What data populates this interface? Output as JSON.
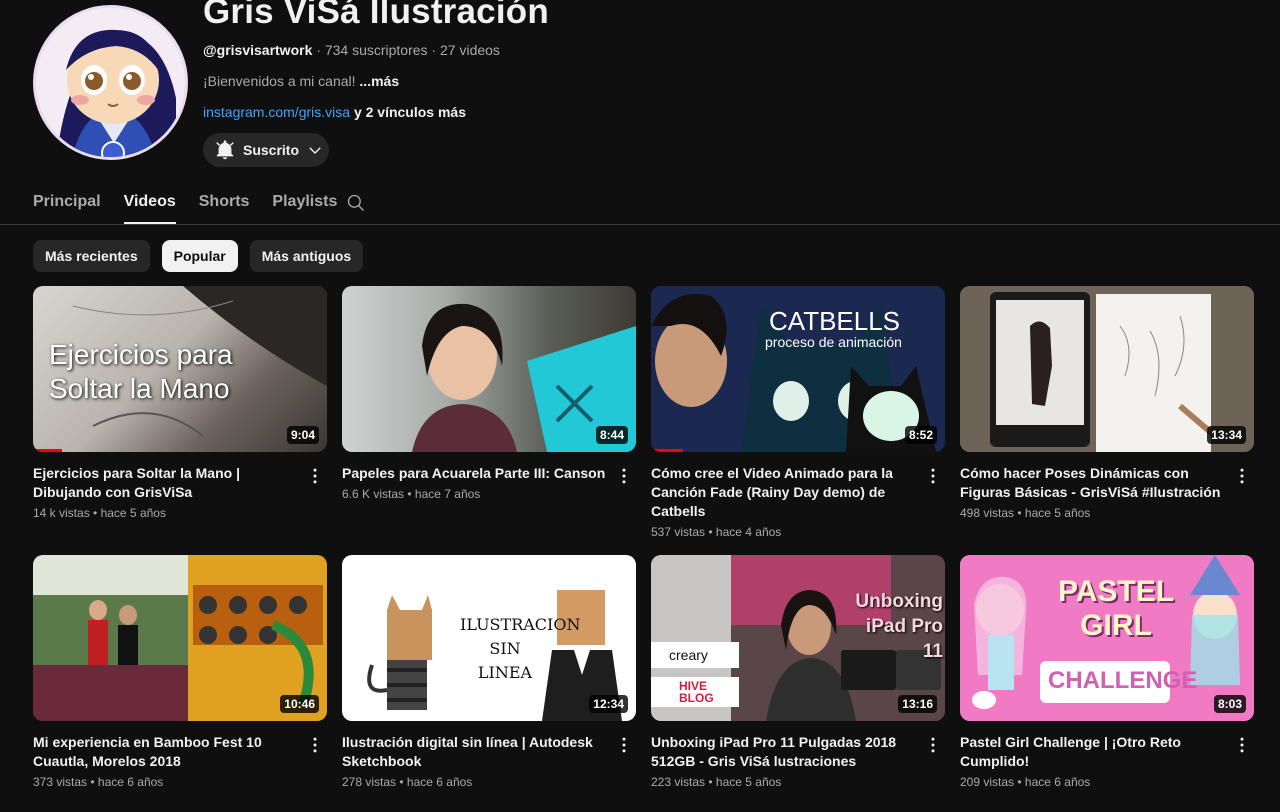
{
  "channel": {
    "name": "Gris ViSá Ilustración",
    "handle": "@grisvisartwork",
    "subscribers": "734 suscriptores",
    "videos_count": "27 videos",
    "separator": " · ",
    "description": "¡Bienvenidos a mi canal!",
    "more_label": "...más",
    "link": "instagram.com/gris.visa",
    "more_links": "y 2 vínculos más",
    "subscribe_label": "Suscrito"
  },
  "tabs": [
    {
      "label": "Principal",
      "active": false
    },
    {
      "label": "Videos",
      "active": true
    },
    {
      "label": "Shorts",
      "active": false
    },
    {
      "label": "Playlists",
      "active": false
    }
  ],
  "chips": [
    {
      "label": "Más recientes",
      "active": false
    },
    {
      "label": "Popular",
      "active": true
    },
    {
      "label": "Más antiguos",
      "active": false
    }
  ],
  "videos": [
    {
      "title": "Ejercicios para Soltar la Mano | Dibujando con GrisViSa",
      "views": "14 k vistas",
      "age": "hace 5 años",
      "duration": "9:04",
      "thumb_text": "Ejercicios para Soltar la Mano",
      "watched": 0.1
    },
    {
      "title": "Papeles para Acuarela Parte III: Canson",
      "views": "6.6 K vistas",
      "age": "hace 7 años",
      "duration": "8:44",
      "thumb_text": "",
      "watched": 0
    },
    {
      "title": "Cómo cree el Video Animado para la Canción Fade (Rainy Day demo) de Catbells",
      "views": "537 vistas",
      "age": "hace 4 años",
      "duration": "8:52",
      "thumb_text": "CATBELLS",
      "thumb_sub": "proceso de animación",
      "watched": 0.11
    },
    {
      "title": "Cómo hacer Poses Dinámicas con Figuras Básicas - GrisViSá #Ilustración",
      "views": "498 vistas",
      "age": "hace 5 años",
      "duration": "13:34",
      "thumb_text": "",
      "watched": 0
    },
    {
      "title": "Mi experiencia en Bamboo Fest 10 Cuautla, Morelos 2018",
      "views": "373 vistas",
      "age": "hace 6 años",
      "duration": "10:46",
      "thumb_text": "",
      "watched": 0
    },
    {
      "title": "Ilustración digital sin línea | Autodesk Sketchbook",
      "views": "278 vistas",
      "age": "hace 6 años",
      "duration": "12:34",
      "thumb_text": "ILUSTRACION SIN LINEA",
      "watched": 0
    },
    {
      "title": "Unboxing iPad Pro 11 Pulgadas 2018 512GB - Gris ViSá lustraciones",
      "views": "223 vistas",
      "age": "hace 5 años",
      "duration": "13:16",
      "thumb_text": "Unboxing iPad Pro 11",
      "thumb_sub": "creary",
      "thumb_sub2": "HIVE BLOG",
      "watched": 0
    },
    {
      "title": "Pastel Girl Challenge | ¡Otro Reto Cumplido!",
      "views": "209 vistas",
      "age": "hace 6 años",
      "duration": "8:03",
      "thumb_text": "PASTEL GIRL",
      "thumb_sub": "CHALLENGE",
      "watched": 0
    }
  ],
  "colors": {
    "accent": "#3ea6ff",
    "progress": "#ff0000",
    "background": "#0f0f0f"
  }
}
